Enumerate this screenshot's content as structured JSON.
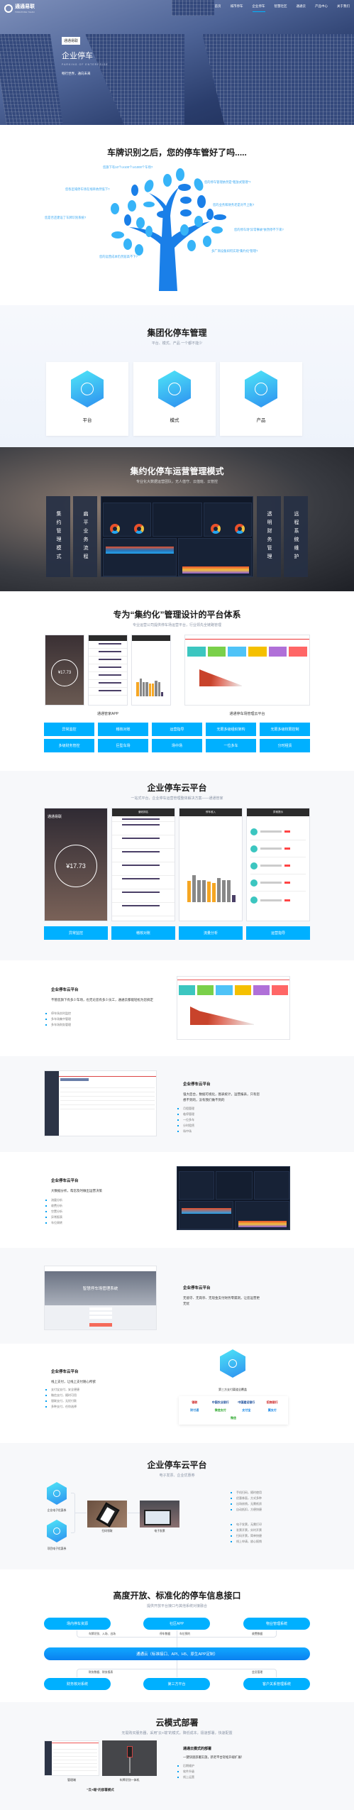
{
  "header": {
    "brand": "通通易联",
    "brand_en": "TONGTONG YILIAN",
    "nav": [
      "首页",
      "城市停车",
      "企业停车",
      "智慧社区",
      "通通云",
      "产品中心",
      "关于我们"
    ],
    "active_nav": "企业停车"
  },
  "hero": {
    "badge": "通通易联",
    "title": "企业停车",
    "subtitle_en": "PARKING OF ENTERPRISE",
    "slogan": "畅行世界，通向未来"
  },
  "tree": {
    "title": "车牌识别之后，您的停车管好了吗.....",
    "questions": [
      "您旗下有10个or100个or1000个车场?",
      "您的停车管理依然是“粗放式管理”?",
      "您各区域停车场在线率依然低下?",
      "您的业务和财务老是对不上账?",
      "您是否还建设了车牌识别系统?",
      "您的停车场“异常事故”依然停不下来?",
      "多厂商设备如何实现“集约化”管理?",
      "您的运营成本仍然居高不下?"
    ]
  },
  "group": {
    "title": "集团化停车管理",
    "subtitle": "平台、模式、产品 一个都不能少",
    "cards": [
      "平台",
      "模式",
      "产品"
    ]
  },
  "intensive": {
    "title": "集约化停车运营管理模式",
    "subtitle": "专业化大数据运营团队，无人值守、云值班、云管控",
    "panels": [
      "集约管理模式",
      "扁平业务流程",
      "透明财务管理",
      "远程系统维护"
    ]
  },
  "platform": {
    "title": "专为“集约化”管理设计的平台体系",
    "subtitle": "专业运营公司提供停车场运营平台，行业领先全链路管理",
    "app_label": "通通管家APP",
    "web_label": "通通停车场管理云平台",
    "app_amount": "¥17.73",
    "buttons": [
      "异常监控",
      "稽核对账",
      "运营指导",
      "无限多级组织架构",
      "无限多级权限控制",
      "多级财务管控",
      "巨型车场",
      "场中场",
      "一位多车",
      "分时租赁"
    ]
  },
  "cloud": {
    "title": "企业停车云平台",
    "subtitle": "一站式平台，企业停车运营管理整体解决方案——通通管家",
    "app_amount": "¥17.73",
    "screens": [
      "通通易联",
      "营收排名",
      "停车收入",
      "异常提示"
    ],
    "buttons": [
      "异常监控",
      "稽核对账",
      "流量分析",
      "运营指导"
    ]
  },
  "features": [
    {
      "title": "企业停车云平台",
      "desc": "不管您旗下有多少车场，也无论您有多少员工，通通云都能轻松为您搞定",
      "bullets": [
        "停车场实时监控",
        "多车场集中管理",
        "多车场财务管理"
      ]
    },
    {
      "title": "企业停车云平台",
      "desc": "强大后台，数据可视化，图表统计，运营报表，只有您想不到的，没有我们做不到的",
      "bullets": [
        "月租管理",
        "临停管理",
        "一位多车",
        "分时租赁",
        "场中场"
      ]
    },
    {
      "title": "企业停车云平台",
      "desc": "大数据分析，帮您及时做出运营决策",
      "bullets": [
        "流量分析",
        "收费分析",
        "空置分析",
        "异常报表",
        "车位周转"
      ]
    },
    {
      "title": "企业停车云平台",
      "desc": "无值守、无岗亭、无现金支付财务零漏洞，让您运营更无忧",
      "login_title": "智慧停车场管理系统",
      "bullets": []
    },
    {
      "title": "企业停车云平台",
      "desc": "线上支付，让线上支付随心所欲",
      "bullets": [
        "支付宝支付，安全便捷",
        "微信支付，随时可用",
        "银联支付，无忧付款",
        "多种支付，任你选择"
      ]
    }
  ],
  "payment": {
    "caption": "第三方支付渠道全覆盖",
    "logos": [
      "银联",
      "中国农业银行",
      "中国建设银行",
      "招商银行",
      "财付通",
      "微信支付",
      "支付宝",
      "翼支付",
      "微信"
    ]
  },
  "coupon": {
    "title": "企业停车云平台",
    "subtitle": "电子发票、企业优惠券",
    "hexes": [
      "企业电子优惠券",
      "项目电子优惠券"
    ],
    "photos": [
      "扫码领取",
      "电子发票"
    ],
    "bullets_a": [
      "手机扫码，随时使用",
      "优惠券面，方式多种",
      "出场核销，无需纸质",
      "自动抵扣，方便快捷"
    ],
    "bullets_b": [
      "电子发票，无需打印",
      "发票开票，实时开票",
      "扫码开票，简单快捷",
      "线上申请，放心报销"
    ]
  },
  "api": {
    "title": "高度开放、标准化的停车信息接口",
    "subtitle": "提供开放平台接口与其他系统对接融合",
    "top": [
      "场内停车资源",
      "社区APP",
      "物业管理系统"
    ],
    "top_labels": [
      "车牌识别、入场、出场",
      "停车数据",
      "车位预约",
      "收费数据"
    ],
    "center": "通通云（标准接口、API、H5、原生APP定制）",
    "bottom_labels": [
      "财务数据、财务报表",
      "会员管理"
    ],
    "bottom": [
      "财务核对系统",
      "第三方平台",
      "客户关系管理系统"
    ]
  },
  "deploy": {
    "title": "云模式部署",
    "subtitle": "无需购买服务器，采用“云+端”的模式，降低成本，极速部署，快速配置",
    "captions": [
      "管理端",
      "车牌识别一体机"
    ],
    "mode": "“云+端”的部署模式",
    "right_title": "通通云模式的部署",
    "right_desc": "一键快速部署实施，新老平台轻松升级扩展！",
    "bullets": [
      "后期维护",
      "软件升级",
      "线上运营"
    ]
  },
  "colors": {
    "accent": "#00b0ff",
    "tree": "#1a7fe8"
  }
}
